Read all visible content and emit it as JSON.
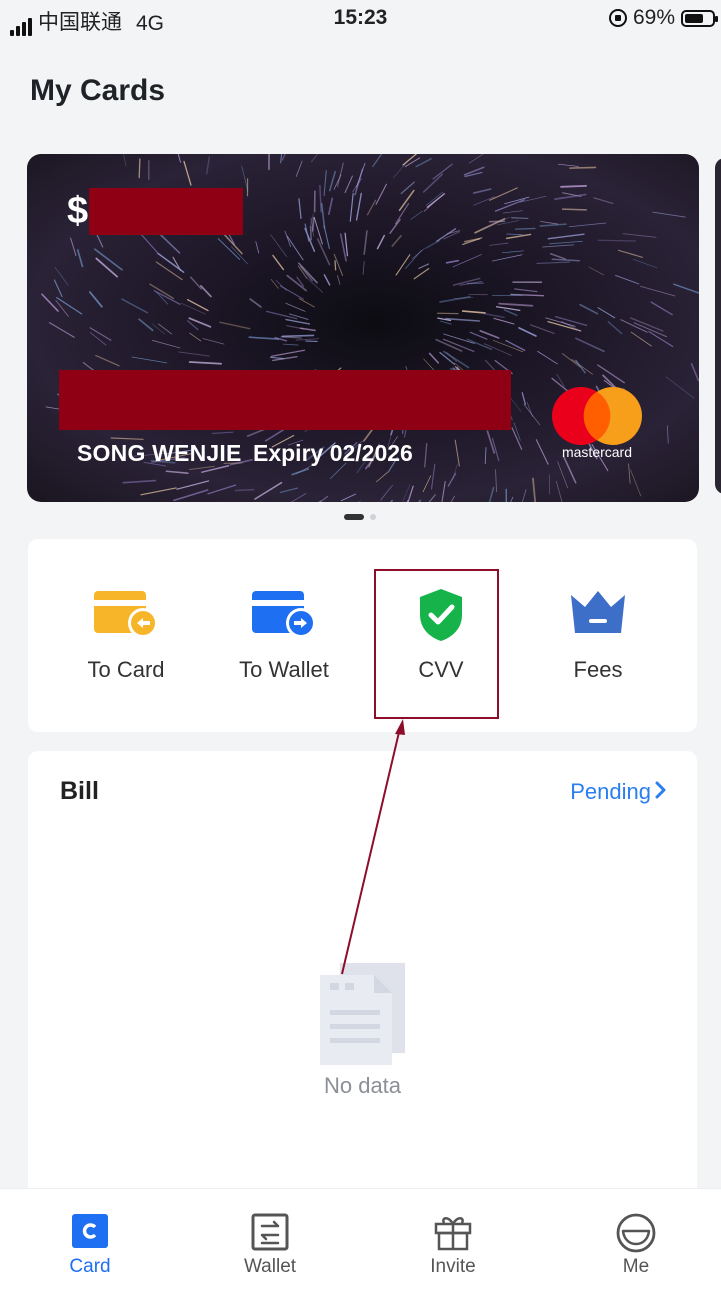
{
  "status_bar": {
    "carrier": "中国联通",
    "network": "4G",
    "time": "15:23",
    "battery": "69%",
    "battery_level": 0.69
  },
  "page": {
    "title": "My Cards"
  },
  "card": {
    "currency_symbol": "$",
    "holder": "SONG WENJIE",
    "expiry": "Expiry 02/2026",
    "brand": "mastercard",
    "brand_colors": {
      "red": "#eb001b",
      "orange": "#f79e1b"
    },
    "pager": {
      "count": 2,
      "active": 0
    }
  },
  "actions": [
    {
      "label": "To Card",
      "icon": "card-in-icon",
      "color": "#f7b62a"
    },
    {
      "label": "To Wallet",
      "icon": "card-out-icon",
      "color": "#1e6ff1"
    },
    {
      "label": "CVV",
      "icon": "shield-check-icon",
      "color": "#16b34a"
    },
    {
      "label": "Fees",
      "icon": "crown-icon",
      "color": "#3d6fc9"
    }
  ],
  "bill": {
    "title": "Bill",
    "pending_label": "Pending",
    "empty_text": "No data"
  },
  "tabbar": {
    "accent": "#1e6ff1",
    "items": [
      {
        "label": "Card",
        "icon": "card-icon",
        "active": true
      },
      {
        "label": "Wallet",
        "icon": "wallet-icon",
        "active": false
      },
      {
        "label": "Invite",
        "icon": "gift-icon",
        "active": false
      },
      {
        "label": "Me",
        "icon": "smiley-icon",
        "active": false
      }
    ]
  }
}
